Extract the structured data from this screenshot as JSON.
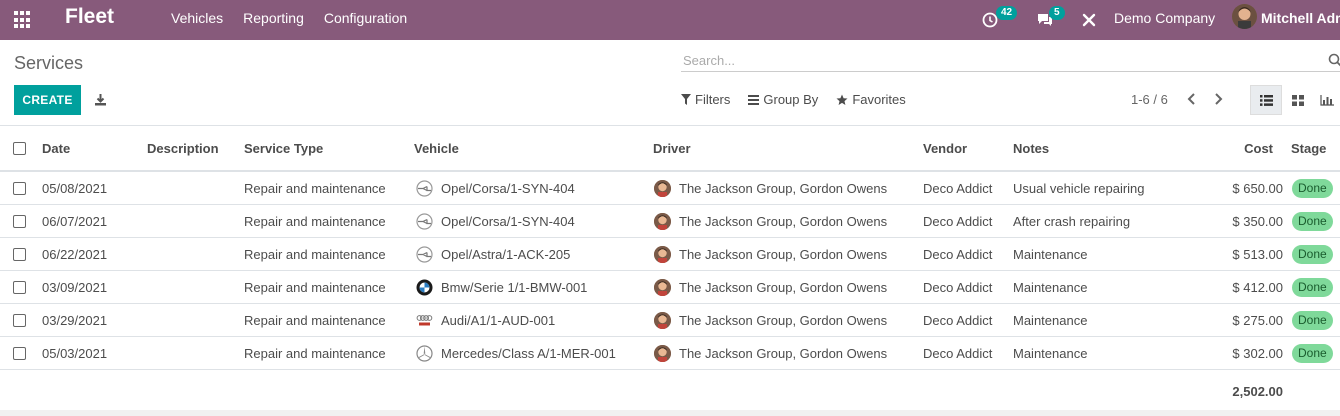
{
  "navbar": {
    "app_name": "Fleet",
    "menu": [
      "Vehicles",
      "Reporting",
      "Configuration"
    ],
    "activity_count": "42",
    "messages_count": "5",
    "company": "Demo Company",
    "user": "Mitchell Admin",
    "bg_color": "#875a7b"
  },
  "control": {
    "title": "Services",
    "search_placeholder": "Search...",
    "create_label": "CREATE",
    "filters_label": "Filters",
    "groupby_label": "Group By",
    "favorites_label": "Favorites",
    "pager": "1-6 / 6"
  },
  "table": {
    "headers": [
      "Date",
      "Description",
      "Service Type",
      "Vehicle",
      "Driver",
      "Vendor",
      "Notes",
      "Cost",
      "Stage"
    ],
    "rows": [
      {
        "date": "05/08/2021",
        "description": "",
        "service_type": "Repair and maintenance",
        "vehicle": "Opel/Corsa/1-SYN-404",
        "brand": "opel",
        "driver": "The Jackson Group, Gordon Owens",
        "vendor": "Deco Addict",
        "notes": "Usual vehicle repairing",
        "cost": "$ 650.00",
        "stage": "Done"
      },
      {
        "date": "06/07/2021",
        "description": "",
        "service_type": "Repair and maintenance",
        "vehicle": "Opel/Corsa/1-SYN-404",
        "brand": "opel",
        "driver": "The Jackson Group, Gordon Owens",
        "vendor": "Deco Addict",
        "notes": "After crash repairing",
        "cost": "$ 350.00",
        "stage": "Done"
      },
      {
        "date": "06/22/2021",
        "description": "",
        "service_type": "Repair and maintenance",
        "vehicle": "Opel/Astra/1-ACK-205",
        "brand": "opel",
        "driver": "The Jackson Group, Gordon Owens",
        "vendor": "Deco Addict",
        "notes": "Maintenance",
        "cost": "$ 513.00",
        "stage": "Done"
      },
      {
        "date": "03/09/2021",
        "description": "",
        "service_type": "Repair and maintenance",
        "vehicle": "Bmw/Serie 1/1-BMW-001",
        "brand": "bmw",
        "driver": "The Jackson Group, Gordon Owens",
        "vendor": "Deco Addict",
        "notes": "Maintenance",
        "cost": "$ 412.00",
        "stage": "Done"
      },
      {
        "date": "03/29/2021",
        "description": "",
        "service_type": "Repair and maintenance",
        "vehicle": "Audi/A1/1-AUD-001",
        "brand": "audi",
        "driver": "The Jackson Group, Gordon Owens",
        "vendor": "Deco Addict",
        "notes": "Maintenance",
        "cost": "$ 275.00",
        "stage": "Done"
      },
      {
        "date": "05/03/2021",
        "description": "",
        "service_type": "Repair and maintenance",
        "vehicle": "Mercedes/Class A/1-MER-001",
        "brand": "mercedes",
        "driver": "The Jackson Group, Gordon Owens",
        "vendor": "Deco Addict",
        "notes": "Maintenance",
        "cost": "$ 302.00",
        "stage": "Done"
      }
    ],
    "total_cost": "2,502.00"
  }
}
